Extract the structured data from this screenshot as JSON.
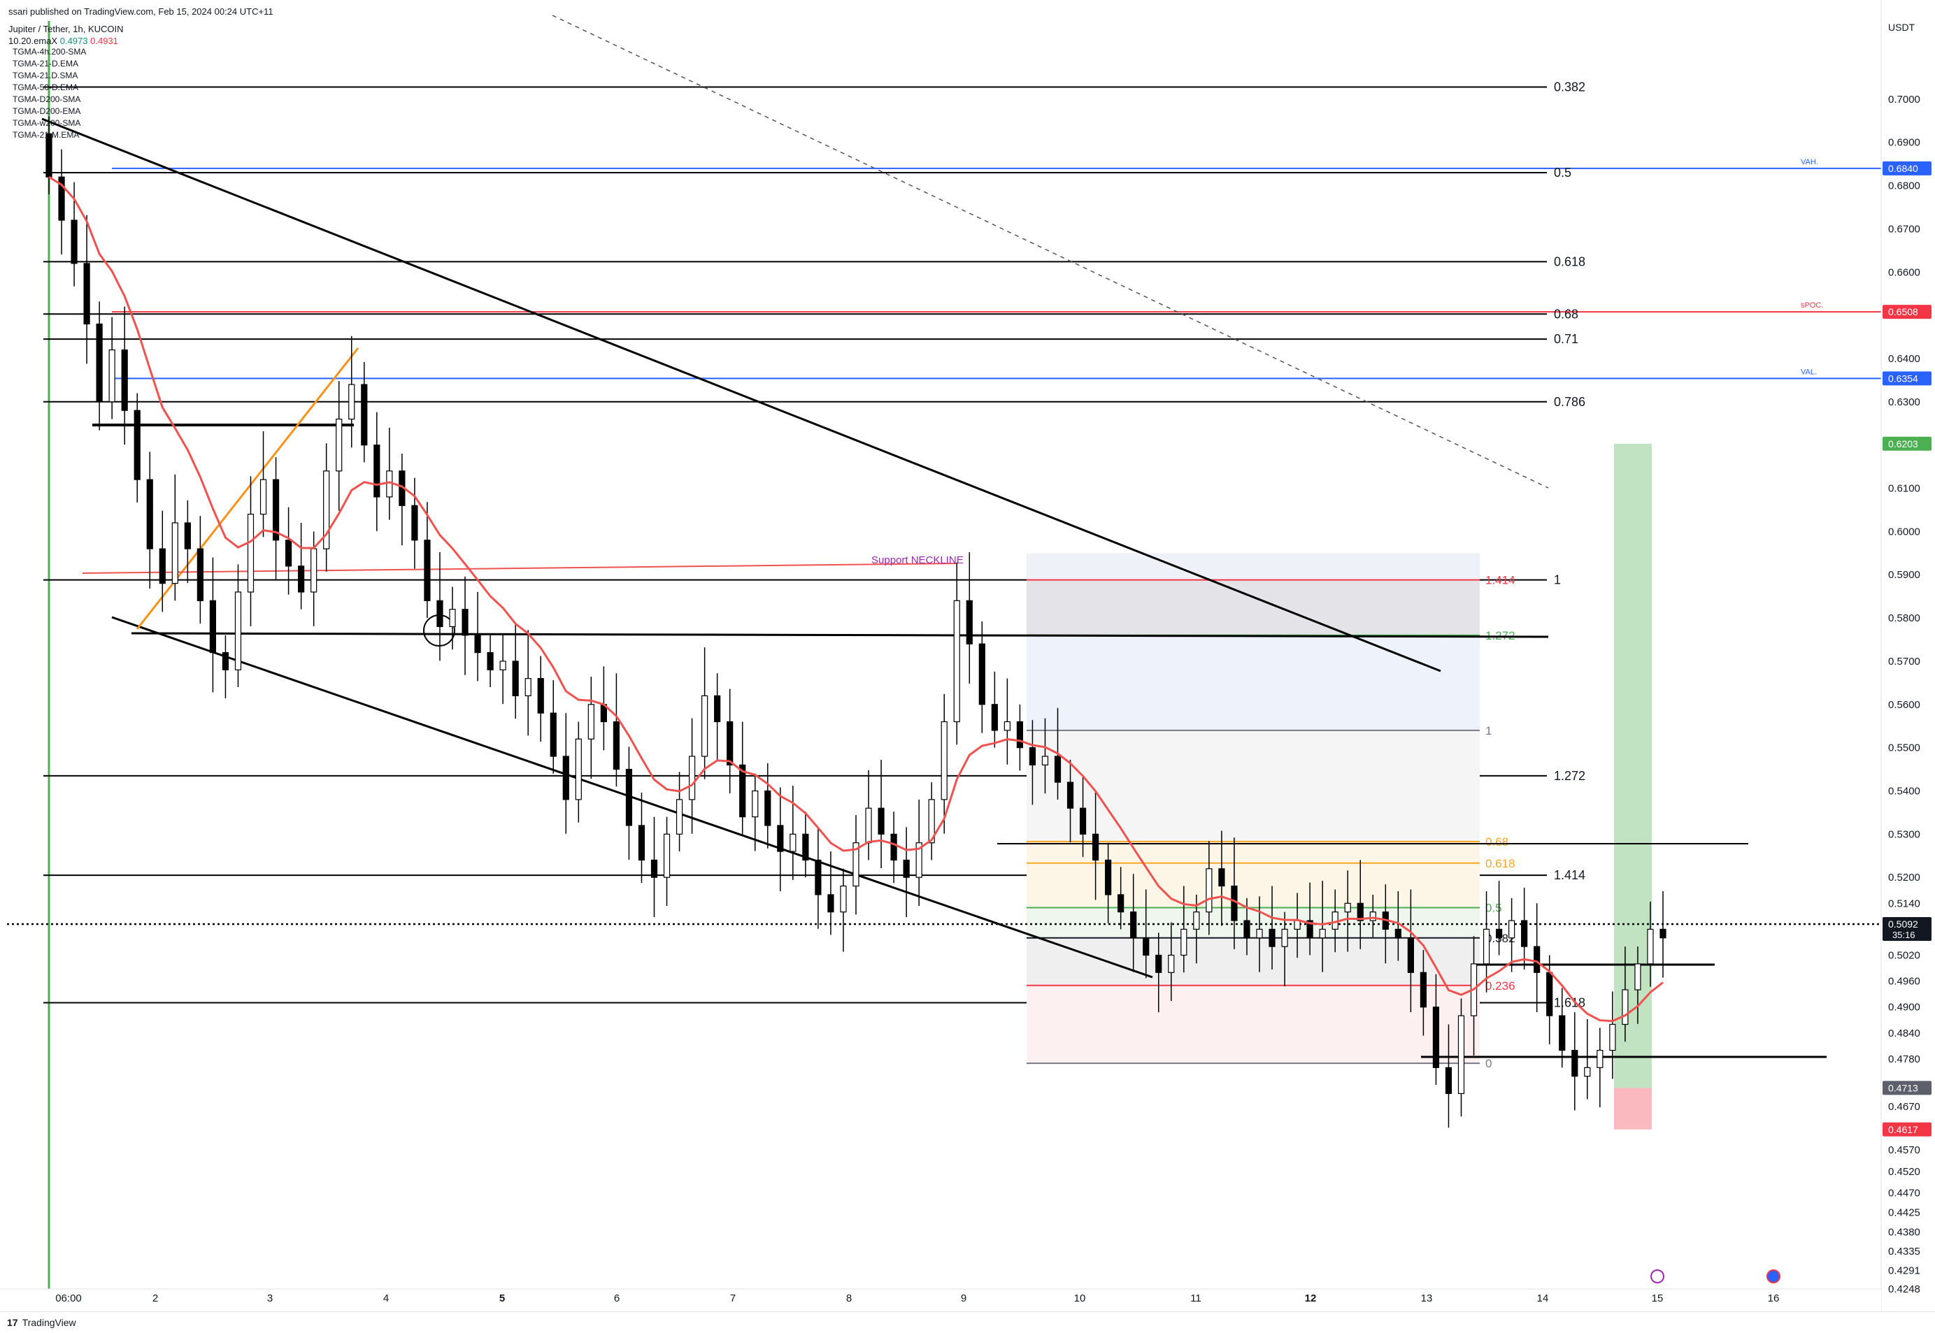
{
  "header": {
    "published": "ssari published on TradingView.com, Feb 15, 2024 00:24 UTC+11",
    "symbol": "Jupiter / Tether, 1h, KUCOIN",
    "ema_label": "10.20.emaX",
    "ema_value_a": "0.4973",
    "ema_value_b": "0.4931",
    "indicators": [
      "TGMA-4h.200-SMA",
      "TGMA-21-D.EMA",
      "TGMA-21.D.SMA",
      "TGMA-50-D.EMA",
      "TGMA-D200-SMA",
      "TGMA-D200-EMA",
      "TGMA-w200-SMA",
      "TGMA-21-M.EMA"
    ]
  },
  "footer": {
    "brand": "TradingView",
    "brand_mark": "17"
  },
  "colors": {
    "up": "#089981",
    "down": "#f23645",
    "ema_fast": "#ef5350",
    "orange": "#f7931a",
    "vah": "#2962ff",
    "spoc": "#f23645",
    "fib_green": "#4caf50",
    "fib_orange": "#f5a623"
  },
  "chart_data": {
    "type": "candlestick",
    "title": "Jupiter / Tether, 1h, KUCOIN",
    "currency": "USDT",
    "xlim": [
      "06:00",
      "16"
    ],
    "x_ticks": [
      "06:00",
      "2",
      "3",
      "4",
      "5",
      "6",
      "7",
      "8",
      "9",
      "10",
      "11",
      "12",
      "13",
      "14",
      "15",
      "16"
    ],
    "ylim": [
      0.4248,
      0.71
    ],
    "y_ticks": [
      0.7,
      0.69,
      0.68,
      0.67,
      0.66,
      0.65,
      0.64,
      0.63,
      0.62,
      0.61,
      0.6,
      0.59,
      0.58,
      0.57,
      0.56,
      0.55,
      0.54,
      0.53,
      0.52,
      0.514,
      0.5092,
      0.502,
      0.496,
      0.49,
      0.484,
      0.478,
      0.4713,
      0.467,
      0.4617,
      0.457,
      0.452,
      0.447,
      0.4425,
      0.438,
      0.4335,
      0.4291,
      0.4248
    ],
    "y_tick_labels": [
      "0.7000",
      "0.6900",
      "0.6800",
      "0.6700",
      "0.6600",
      "0.6500",
      "0.6400",
      "0.6300",
      "0.6200",
      "0.6100",
      "0.6000",
      "0.5900",
      "0.5800",
      "0.5700",
      "0.5600",
      "0.5500",
      "0.5400",
      "0.5300",
      "0.5200",
      "0.5140",
      "",
      "0.5020",
      "0.4960",
      "0.4900",
      "0.4840",
      "0.4780",
      "",
      "0.4670",
      "",
      "0.4570",
      "0.4520",
      "0.4470",
      "0.4425",
      "0.4380",
      "0.4335",
      "0.4291",
      "0.4248"
    ],
    "price_tags": [
      {
        "value": 0.684,
        "label": "0.6840",
        "color": "#2962ff"
      },
      {
        "value": 0.6508,
        "label": "0.6508",
        "color": "#f23645"
      },
      {
        "value": 0.6354,
        "label": "0.6354",
        "color": "#2962ff"
      },
      {
        "value": 0.6203,
        "label": "0.6203",
        "color": "#4caf50"
      },
      {
        "value": 0.5092,
        "label": "0.5092",
        "sub": "35:16",
        "color": "#131722"
      },
      {
        "value": 0.4713,
        "label": "0.4713",
        "color": "#5d606b"
      },
      {
        "value": 0.4617,
        "label": "0.4617",
        "color": "#f23645"
      }
    ],
    "volume_profile_lines": [
      {
        "value": 0.684,
        "label": "VAH",
        "color": "#2962ff"
      },
      {
        "value": 0.6508,
        "label": "sPOC",
        "color": "#f23645"
      },
      {
        "value": 0.6354,
        "label": "VAL",
        "color": "#2962ff"
      }
    ],
    "fib_extension_levels": [
      {
        "value": 0.7028,
        "label": "0.382"
      },
      {
        "value": 0.683,
        "label": "0.5"
      },
      {
        "value": 0.6624,
        "label": "0.618"
      },
      {
        "value": 0.6503,
        "label": "0.68"
      },
      {
        "value": 0.6445,
        "label": "0.71"
      },
      {
        "value": 0.63,
        "label": "0.786"
      },
      {
        "value": 0.5888,
        "label": "1"
      },
      {
        "value": 0.5435,
        "label": "1.272"
      },
      {
        "value": 0.5205,
        "label": "1.414"
      },
      {
        "value": 0.491,
        "label": "1.618"
      }
    ],
    "fib_retracement_box": [
      {
        "value": 0.5888,
        "label": "1.414",
        "color": "#f23645"
      },
      {
        "value": 0.576,
        "label": "1.272",
        "color": "#4caf50"
      },
      {
        "value": 0.554,
        "label": "1",
        "color": "#787b86"
      },
      {
        "value": 0.5283,
        "label": "0.68",
        "color": "#f5a623"
      },
      {
        "value": 0.5233,
        "label": "0.618",
        "color": "#f5a623"
      },
      {
        "value": 0.513,
        "label": "0.5",
        "color": "#4caf50"
      },
      {
        "value": 0.506,
        "label": "0.382",
        "color": "#131722"
      },
      {
        "value": 0.495,
        "label": "0.236",
        "color": "#f23645"
      },
      {
        "value": 0.477,
        "label": "0",
        "color": "#787b86"
      }
    ],
    "annotations": [
      {
        "text": "Support NECKLINE",
        "value": 0.569,
        "color": "#9c27b0"
      }
    ],
    "position_tool": {
      "entry": 0.4713,
      "target": 0.6203,
      "stop": 0.4617
    },
    "series": [
      {
        "name": "JUP/USDT",
        "close": [
          0.682,
          0.672,
          0.662,
          0.648,
          0.63,
          0.642,
          0.628,
          0.612,
          0.596,
          0.588,
          0.602,
          0.596,
          0.584,
          0.572,
          0.568,
          0.586,
          0.604,
          0.612,
          0.598,
          0.592,
          0.586,
          0.596,
          0.614,
          0.626,
          0.634,
          0.62,
          0.608,
          0.614,
          0.606,
          0.598,
          0.584,
          0.578,
          0.582,
          0.576,
          0.572,
          0.568,
          0.57,
          0.562,
          0.566,
          0.558,
          0.548,
          0.538,
          0.552,
          0.56,
          0.556,
          0.545,
          0.532,
          0.524,
          0.52,
          0.53,
          0.538,
          0.548,
          0.562,
          0.556,
          0.546,
          0.534,
          0.54,
          0.532,
          0.526,
          0.53,
          0.524,
          0.516,
          0.512,
          0.518,
          0.528,
          0.536,
          0.53,
          0.524,
          0.52,
          0.528,
          0.538,
          0.556,
          0.584,
          0.574,
          0.56,
          0.554,
          0.556,
          0.55,
          0.546,
          0.548,
          0.542,
          0.536,
          0.53,
          0.524,
          0.516,
          0.512,
          0.506,
          0.502,
          0.498,
          0.502,
          0.508,
          0.512,
          0.522,
          0.518,
          0.51,
          0.506,
          0.508,
          0.504,
          0.508,
          0.51,
          0.506,
          0.508,
          0.512,
          0.514,
          0.51,
          0.512,
          0.508,
          0.506,
          0.498,
          0.49,
          0.476,
          0.47,
          0.488,
          0.5,
          0.508,
          0.506,
          0.51,
          0.504,
          0.498,
          0.488,
          0.48,
          0.474,
          0.476,
          0.48,
          0.486,
          0.494,
          0.5,
          0.508,
          0.506
        ]
      }
    ]
  }
}
